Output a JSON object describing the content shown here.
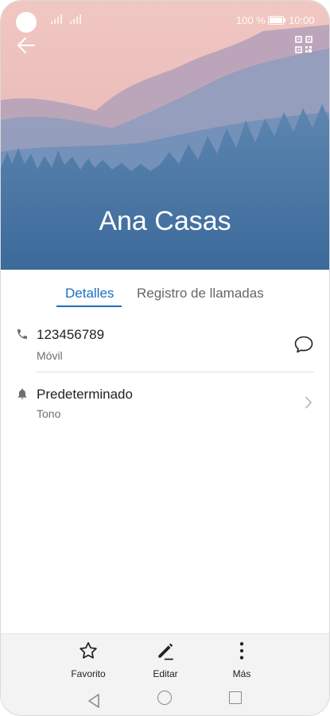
{
  "status_bar": {
    "battery": "100 %",
    "time": "10:00"
  },
  "contact": {
    "name": "Ana Casas"
  },
  "tabs": [
    {
      "label": "Detalles",
      "active": true
    },
    {
      "label": "Registro de llamadas",
      "active": false
    }
  ],
  "details": {
    "phone": {
      "number": "123456789",
      "type": "Móvil",
      "icon": "phone-icon",
      "action_icon": "message-icon"
    },
    "ringtone": {
      "value": "Predeterminado",
      "label": "Tono",
      "icon": "bell-icon"
    }
  },
  "actions": [
    {
      "label": "Favorito",
      "icon": "star-icon"
    },
    {
      "label": "Editar",
      "icon": "pencil-icon"
    },
    {
      "label": "Más",
      "icon": "more-vertical-icon"
    }
  ],
  "colors": {
    "accent": "#1a6fc4",
    "header_sky": "#f0c6c3",
    "header_forest": "#3f6f9e"
  }
}
